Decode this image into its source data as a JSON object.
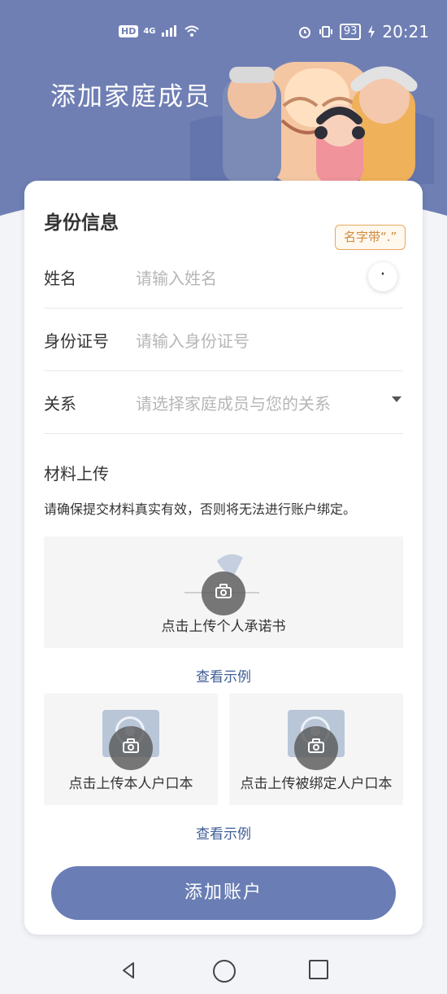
{
  "status_bar": {
    "hd": "HD",
    "network": "4G",
    "battery": "93",
    "time": "20:21",
    "icons": [
      "signal-icon",
      "wifi-icon",
      "alarm-icon",
      "vibrate-icon",
      "battery-icon",
      "charging-icon"
    ]
  },
  "header": {
    "title": "添加家庭成员",
    "illustration": "family-illustration"
  },
  "form": {
    "section_title": "身份信息",
    "tooltip": "名字带“.”",
    "dot_button": "·",
    "fields": [
      {
        "label": "姓名",
        "placeholder": "请输入姓名"
      },
      {
        "label": "身份证号",
        "placeholder": "请输入身份证号"
      },
      {
        "label": "关系",
        "placeholder": "请选择家庭成员与您的关系"
      }
    ]
  },
  "upload": {
    "title": "材料上传",
    "note": "请确保提交材料真实有效，否则将无法进行账户绑定。",
    "promise_label": "点击上传个人承诺书",
    "example_link": "查看示例",
    "own_label": "点击上传本人户口本",
    "bound_label": "点击上传被绑定人户口本",
    "example_link_2": "查看示例"
  },
  "action": {
    "submit": "添加账户"
  },
  "navigation": {
    "buttons": [
      "back",
      "home",
      "recent-apps"
    ]
  },
  "colors": {
    "primary": "#6f7fb4",
    "link": "#3f5d94",
    "tooltip": "#d08a3a"
  }
}
